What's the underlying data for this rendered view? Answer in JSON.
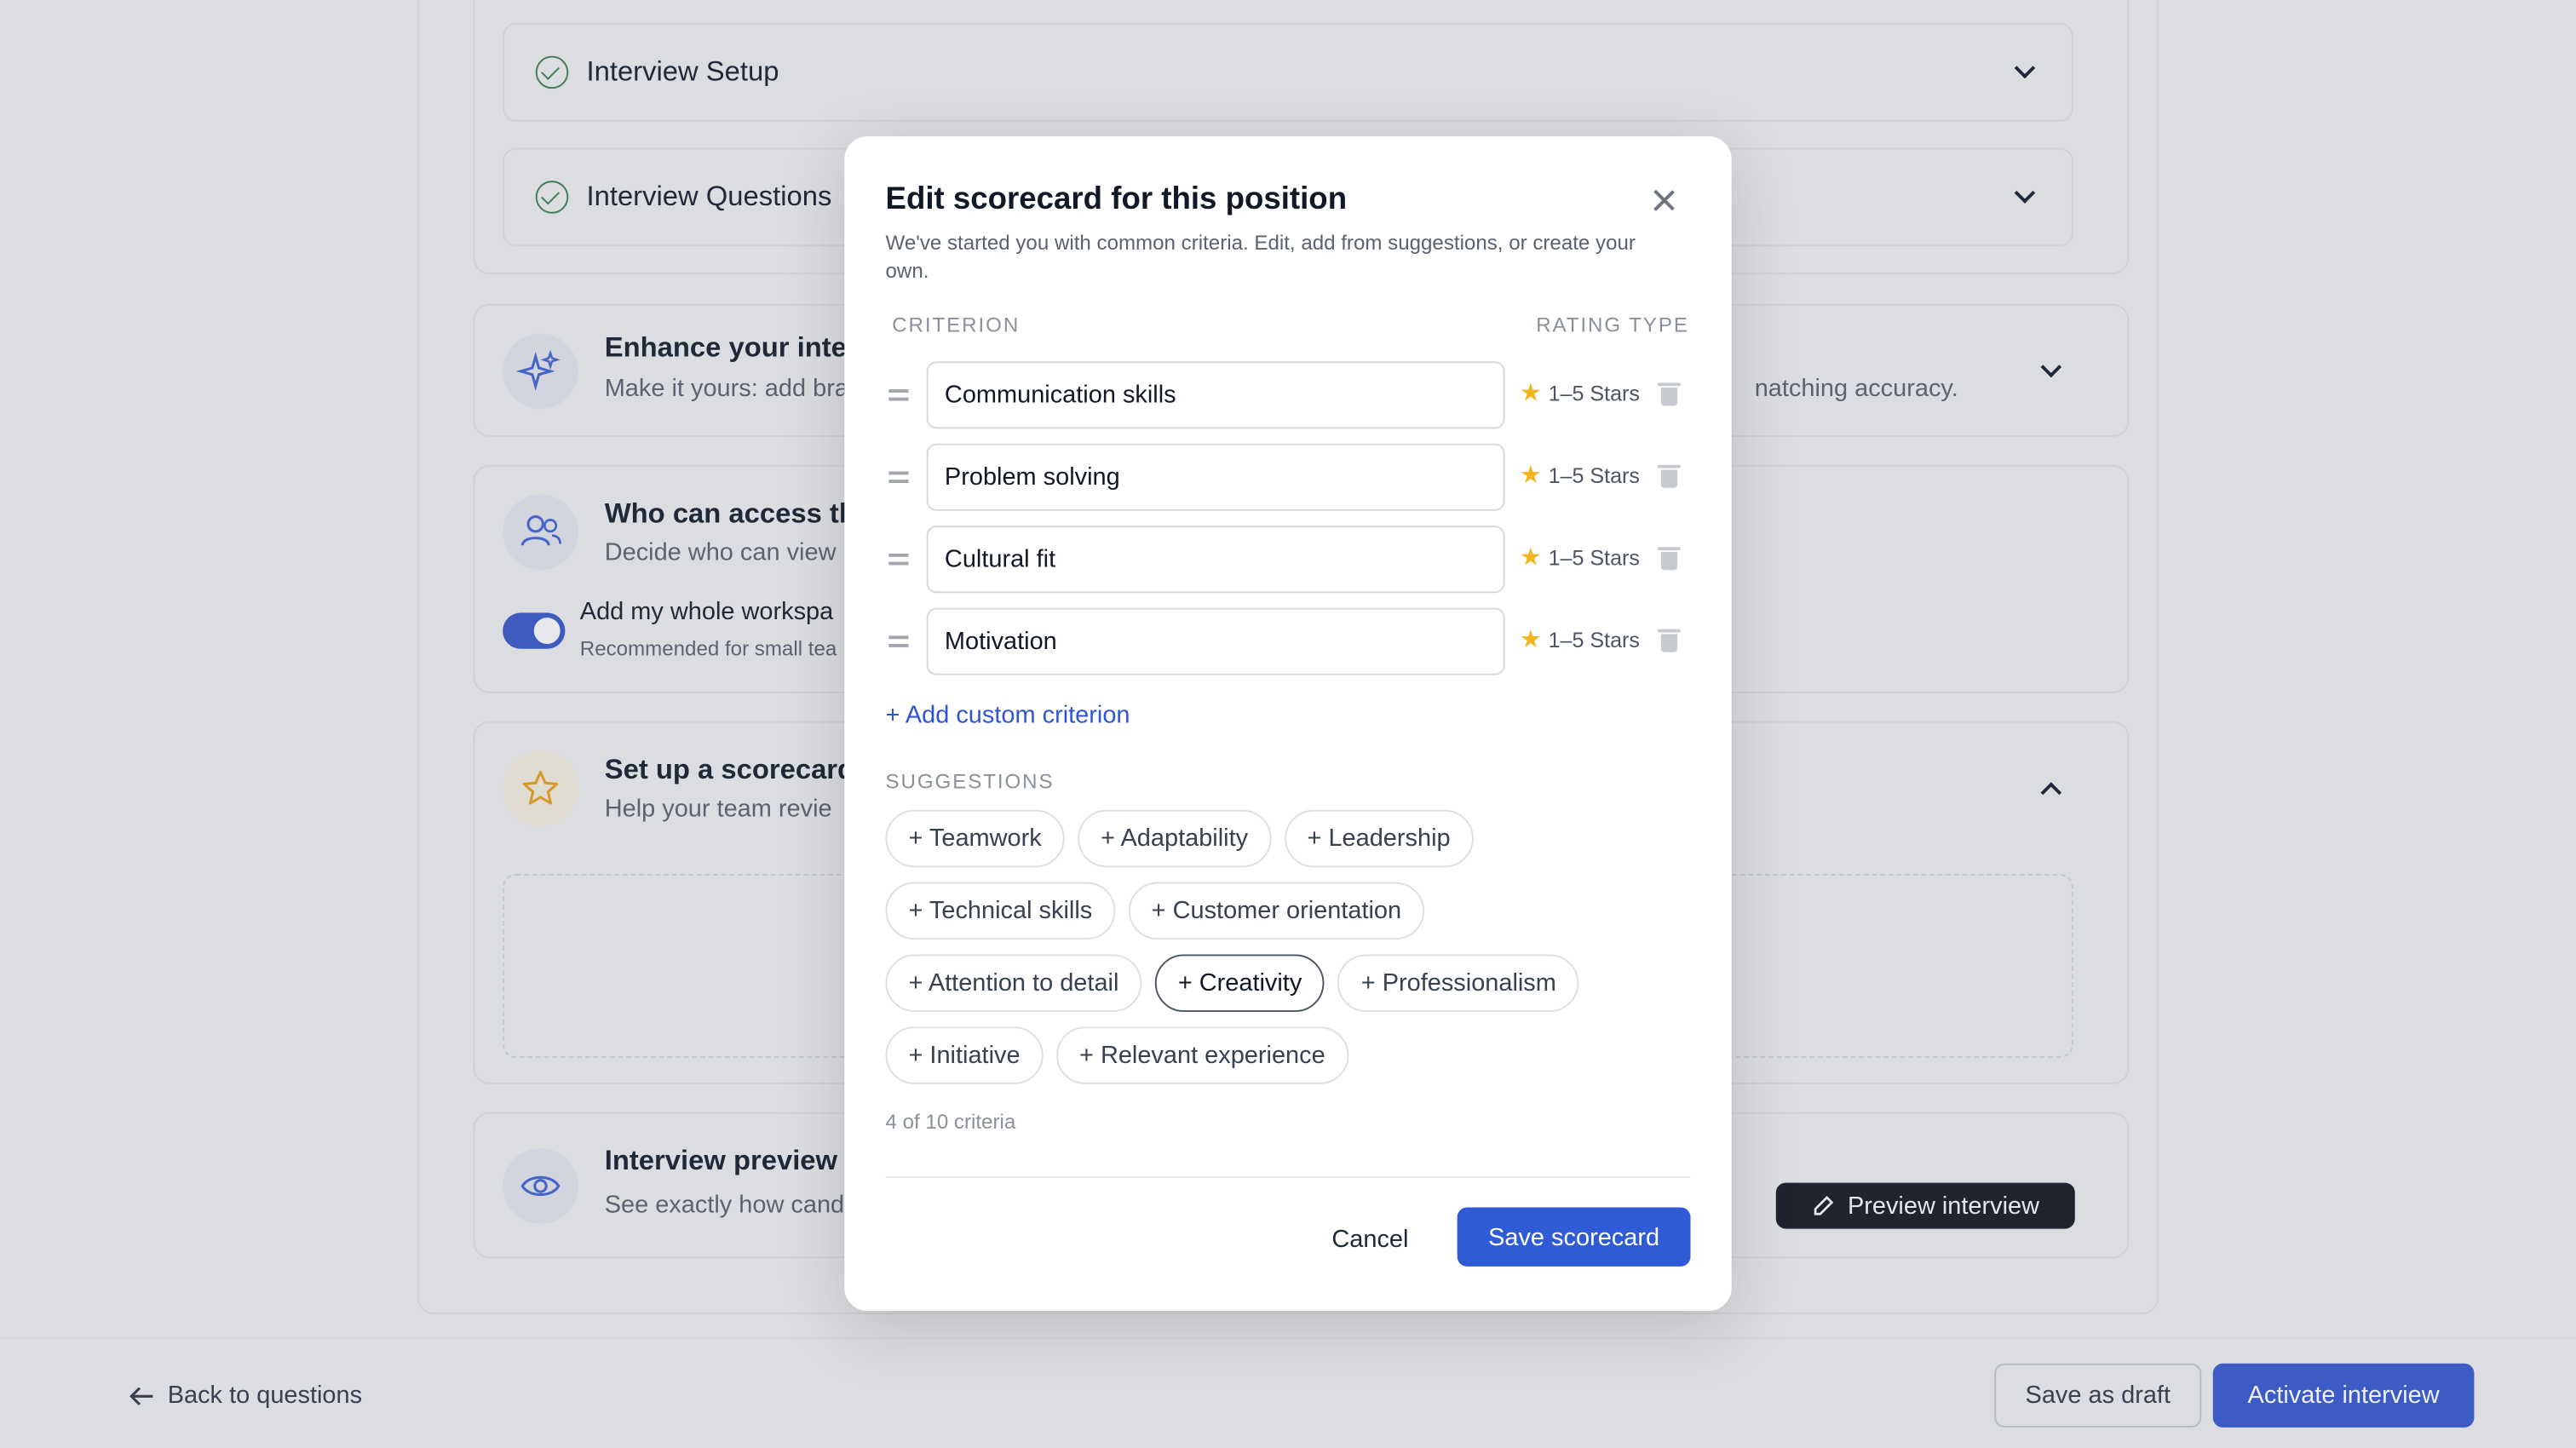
{
  "colors": {
    "accent": "#2f5bd6",
    "activate": "#3d5bc4",
    "star": "#f2b51f",
    "check": "#3f7c55"
  },
  "background": {
    "interview_setup": {
      "label": "Interview Setup"
    },
    "interview_questions": {
      "label": "Interview Questions"
    },
    "enhance": {
      "title": "Enhance your inter",
      "subtitle": "Make it yours: add bra",
      "subtitle_right": "natching accuracy."
    },
    "access": {
      "title": "Who can access th",
      "subtitle": "Decide who can view",
      "toggle_label": "Add my whole workspa",
      "toggle_sub": "Recommended for small tea"
    },
    "scorecard": {
      "title": "Set up a scorecard",
      "subtitle": "Help your team revie"
    },
    "preview": {
      "title": "Interview preview",
      "subtitle": "See exactly how cand",
      "button": "Preview interview"
    }
  },
  "footer": {
    "back_label": "Back to questions",
    "draft_label": "Save as draft",
    "activate_label": "Activate interview"
  },
  "modal": {
    "title": "Edit scorecard for this position",
    "description": "We've started you with common criteria. Edit, add from suggestions, or create your own.",
    "col_criterion": "CRITERION",
    "col_rating": "RATING TYPE",
    "criteria": [
      {
        "name": "Communication skills",
        "rating": "1–5 Stars"
      },
      {
        "name": "Problem solving",
        "rating": "1–5 Stars"
      },
      {
        "name": "Cultural fit",
        "rating": "1–5 Stars"
      },
      {
        "name": "Motivation",
        "rating": "1–5 Stars"
      }
    ],
    "add_custom": "+ Add custom criterion",
    "suggestions_label": "SUGGESTIONS",
    "suggestions": [
      "+ Teamwork",
      "+ Adaptability",
      "+ Leadership",
      "+ Technical skills",
      "+ Customer orientation",
      "+ Attention to detail",
      "+ Creativity",
      "+ Professionalism",
      "+ Initiative",
      "+ Relevant experience"
    ],
    "count": "4 of 10 criteria",
    "cancel_label": "Cancel",
    "save_label": "Save scorecard"
  }
}
